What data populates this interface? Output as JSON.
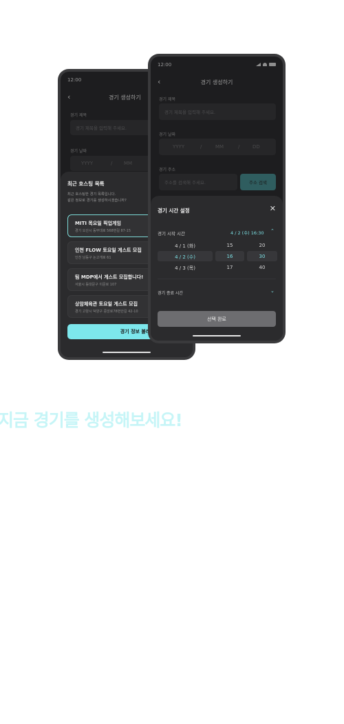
{
  "left_phone": {
    "time": "12:00",
    "header_title": "경기 생성하기",
    "labels": {
      "title": "경기 제목",
      "date": "경기 날짜"
    },
    "title_placeholder": "경기 제목을 입력해 주세요.",
    "date_placeholders": [
      "YYYY",
      "/",
      "MM"
    ],
    "sheet": {
      "title": "최근 호스팅 목록",
      "desc_line1": "최근 호스팅한 경기 목록입니다.",
      "desc_line2": "같은 정보로 경기를 생성하시겠습니까?",
      "items": [
        {
          "title": "MITI 목요일 픽업게임",
          "addr": "경기 오산시 동부대로 568번길 87-15",
          "selected": true
        },
        {
          "title": "인천 FLOW 토요일 게스트 모집",
          "addr": "인천 남동구 논고개로 61",
          "selected": false
        },
        {
          "title": "팀 MDP에서 게스트 모집합니다!",
          "addr": "서울시 동대문구 이문로 107",
          "selected": false
        },
        {
          "title": "상암체육관 토요일 게스트 모집",
          "addr": "경기 고양시 덕양구 중앙로78번안길 42-10",
          "selected": false
        }
      ],
      "button": "경기 정보 불러오기"
    }
  },
  "right_phone": {
    "time": "12:00",
    "header_title": "경기 생성하기",
    "labels": {
      "title": "경기 제목",
      "date": "경기 날짜",
      "address": "경기 주소"
    },
    "title_placeholder": "경기 제목을 입력해 주세요.",
    "date_placeholders": [
      "YYYY",
      "/",
      "MM",
      "/",
      "DD"
    ],
    "address_placeholder": "주소를 검색해 주세요.",
    "address_button": "주소 검색",
    "sheet": {
      "title": "경기 시간 설정",
      "start_label": "경기 시작 시간",
      "start_value": "4 / 2 (수) 16:30",
      "end_label": "경기 종료 시간",
      "days": [
        "4 / 1 (화)",
        "4 / 2 (수)",
        "4 / 3 (목)"
      ],
      "hours": [
        "15",
        "16",
        "17"
      ],
      "minutes": [
        "20",
        "30",
        "40"
      ],
      "confirm": "선택 완료"
    }
  },
  "headline": "지금 경기를 생성해보세요!",
  "colors": {
    "accent": "#7de7ec",
    "phone_bg": "#1d1d1f",
    "headline": "#c6f5f7"
  }
}
